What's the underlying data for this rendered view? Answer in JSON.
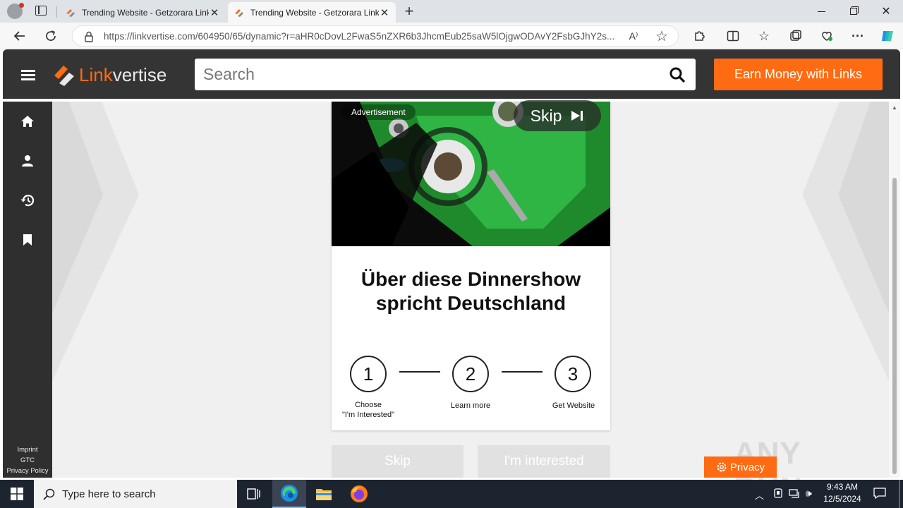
{
  "browser": {
    "tabs": [
      {
        "title": "Trending Website - Getzorara Link",
        "active": false
      },
      {
        "title": "Trending Website - Getzorara Link",
        "active": true
      }
    ],
    "url": "https://linkvertise.com/604950/65/dynamic?r=aHR0cDovL2FwaS5nZXR6b3JhcmEub25saW5lOjgwODAvY2FsbGJhY2s..."
  },
  "site": {
    "logo": {
      "part1": "Link",
      "part2": "vertise"
    },
    "search_placeholder": "Search",
    "earn_button": "Earn Money with Links",
    "footer_links": [
      "Imprint",
      "GTC",
      "Privacy Policy"
    ]
  },
  "ad": {
    "label": "Advertisement",
    "skip_label": "Skip",
    "headline_line1": "Über diese Dinnershow",
    "headline_line2": "spricht Deutschland"
  },
  "steps": [
    {
      "number": "1",
      "label": "Choose\n\"I'm Interested\""
    },
    {
      "number": "2",
      "label": "Learn more"
    },
    {
      "number": "3",
      "label": "Get Website"
    }
  ],
  "buttons": {
    "skip": "Skip",
    "interested": "I'm interested"
  },
  "privacy_button": "Privacy",
  "watermark": "ANY RUN",
  "taskbar": {
    "search_placeholder": "Type here to search",
    "time": "9:43 AM",
    "date": "12/5/2024"
  },
  "colors": {
    "accent": "#ff6b13",
    "header_bg": "#343434",
    "sidebar_bg": "#2f2f2f",
    "content_bg": "#f0f0f0"
  }
}
